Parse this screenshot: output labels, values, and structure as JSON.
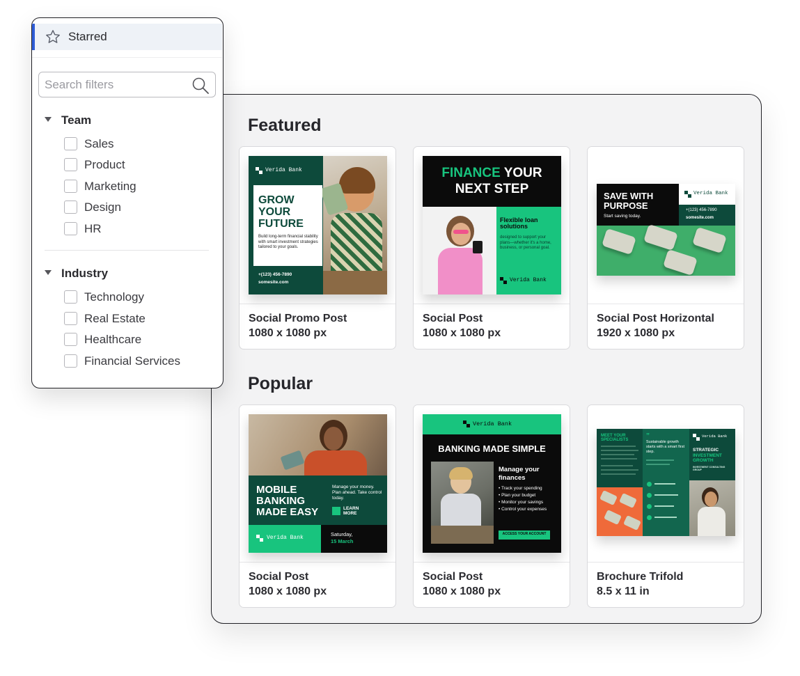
{
  "filters": {
    "starred_label": "Starred",
    "search": {
      "placeholder": "Search filters"
    },
    "groups": [
      {
        "label": "Team",
        "options": [
          "Sales",
          "Product",
          "Marketing",
          "Design",
          "HR"
        ]
      },
      {
        "label": "Industry",
        "options": [
          "Technology",
          "Real Estate",
          "Healthcare",
          "Financial Services"
        ]
      }
    ]
  },
  "gallery": {
    "sections": [
      {
        "title": "Featured",
        "cards": [
          {
            "name": "Social Promo Post",
            "size": "1080 x 1080 px"
          },
          {
            "name": "Social Post",
            "size": "1080 x 1080 px"
          },
          {
            "name": "Social Post Horizontal",
            "size": "1920 x 1080 px"
          }
        ]
      },
      {
        "title": "Popular",
        "cards": [
          {
            "name": "Social Post",
            "size": "1080 x 1080 px"
          },
          {
            "name": "Social Post",
            "size": "1080 x 1080 px"
          },
          {
            "name": "Brochure Trifold",
            "size": "8.5 x 11 in"
          }
        ]
      }
    ]
  },
  "thumbnails": {
    "promo": {
      "brand": "Verida Bank",
      "headline": "GROW YOUR FUTURE",
      "body": "Build long-term financial stability with smart investment strategies tailored to your goals.",
      "phone": "+(123) 456-7890",
      "site": "somesite.com"
    },
    "finance_step": {
      "headline_accent": "FINANCE",
      "headline_rest_1": "YOUR",
      "headline_rest_2": "NEXT STEP",
      "sub": "Flexible loan solutions",
      "body": "designed to support your plans—whether it's a home, business, or personal goal.",
      "brand": "Verida Bank"
    },
    "save_purpose": {
      "headline": "SAVE WITH PURPOSE",
      "sub": "Start saving today.",
      "brand": "Verida Bank",
      "phone": "+(123) 456-7890",
      "site": "somesite.com"
    },
    "mobile_banking": {
      "headline": "MOBILE BANKING MADE EASY",
      "body": "Manage your money. Plan ahead. Take control today.",
      "cta": "LEARN MORE",
      "brand": "Verida Bank",
      "date_line": "Saturday,",
      "date": "15 March"
    },
    "banking_simple": {
      "brand": "Verida Bank",
      "headline": "BANKING MADE SIMPLE",
      "sub": "Manage your finances",
      "bullets": [
        "Track your spending",
        "Plan your budget",
        "Monitor your savings",
        "Control your expenses"
      ],
      "cta": "ACCESS YOUR ACCOUNT"
    },
    "brochure": {
      "meet": "MEET YOUR SPECIALISTS",
      "growth": "Sustainable growth starts with a smart first step.",
      "brand": "Verida Bank",
      "strategic": "STRATEGIC",
      "investment": "INVESTMENT GROWTH",
      "group": "INVESTMENT CONSULTING GROUP"
    }
  },
  "colors": {
    "brand_dark_green": "#0d4a3b",
    "brand_mint": "#18c47e",
    "brand_black": "#0b0b0b",
    "starred_accent": "#2e5cd6"
  }
}
